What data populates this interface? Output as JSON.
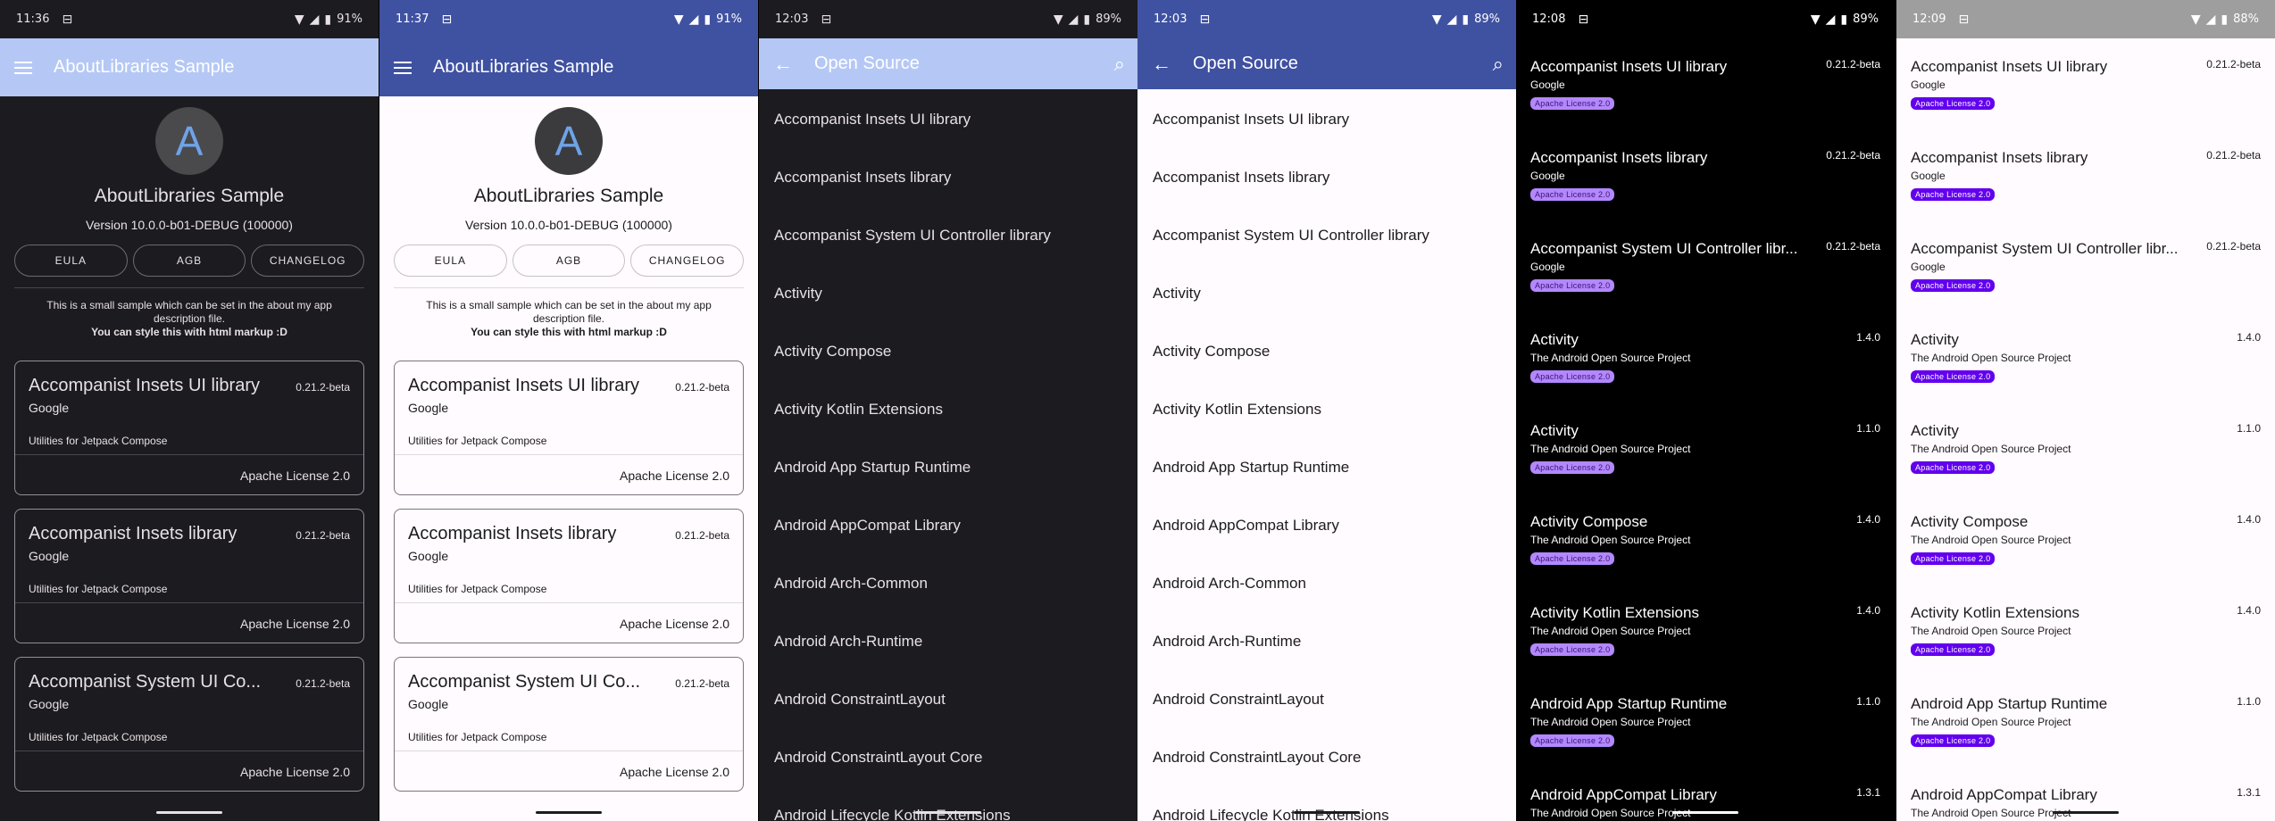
{
  "screens": [
    {
      "status": {
        "time": "11:36",
        "battery": "91%"
      },
      "appbar": {
        "title": "AboutLibraries Sample"
      },
      "header": {
        "logo_letter": "A",
        "app_name": "AboutLibraries Sample",
        "version": "Version 10.0.0-b01-DEBUG (100000)",
        "buttons": [
          "EULA",
          "AGB",
          "CHANGELOG"
        ],
        "desc_line1": "This is a small sample which can be set in the about my app description file.",
        "desc_line2": "You can style this with html markup :D"
      },
      "cards": [
        {
          "name": "Accompanist Insets UI library",
          "version": "0.21.2-beta",
          "author": "Google",
          "desc": "Utilities for Jetpack Compose",
          "license": "Apache License 2.0"
        },
        {
          "name": "Accompanist Insets library",
          "version": "0.21.2-beta",
          "author": "Google",
          "desc": "Utilities for Jetpack Compose",
          "license": "Apache License 2.0"
        },
        {
          "name": "Accompanist System UI Co...",
          "version": "0.21.2-beta",
          "author": "Google",
          "desc": "Utilities for Jetpack Compose",
          "license": "Apache License 2.0"
        }
      ]
    },
    {
      "status": {
        "time": "11:37",
        "battery": "91%"
      },
      "appbar": {
        "title": "AboutLibraries Sample"
      },
      "header": {
        "logo_letter": "A",
        "app_name": "AboutLibraries Sample",
        "version": "Version 10.0.0-b01-DEBUG (100000)",
        "buttons": [
          "EULA",
          "AGB",
          "CHANGELOG"
        ],
        "desc_line1": "This is a small sample which can be set in the about my app description file.",
        "desc_line2": "You can style this with html markup :D"
      },
      "cards": [
        {
          "name": "Accompanist Insets UI library",
          "version": "0.21.2-beta",
          "author": "Google",
          "desc": "Utilities for Jetpack Compose",
          "license": "Apache License 2.0"
        },
        {
          "name": "Accompanist Insets library",
          "version": "0.21.2-beta",
          "author": "Google",
          "desc": "Utilities for Jetpack Compose",
          "license": "Apache License 2.0"
        },
        {
          "name": "Accompanist System UI Co...",
          "version": "0.21.2-beta",
          "author": "Google",
          "desc": "Utilities for Jetpack Compose",
          "license": "Apache License 2.0"
        }
      ]
    },
    {
      "status": {
        "time": "12:03",
        "battery": "89%"
      },
      "appbar": {
        "title": "Open Source"
      },
      "items": [
        "Accompanist Insets UI library",
        "Accompanist Insets library",
        "Accompanist System UI Controller library",
        "Activity",
        "Activity Compose",
        "Activity Kotlin Extensions",
        "Android App Startup Runtime",
        "Android AppCompat Library",
        "Android Arch-Common",
        "Android Arch-Runtime",
        "Android ConstraintLayout",
        "Android ConstraintLayout Core",
        "Android Lifecycle Kotlin Extensions"
      ]
    },
    {
      "status": {
        "time": "12:03",
        "battery": "89%"
      },
      "appbar": {
        "title": "Open Source"
      },
      "items": [
        "Accompanist Insets UI library",
        "Accompanist Insets library",
        "Accompanist System UI Controller library",
        "Activity",
        "Activity Compose",
        "Activity Kotlin Extensions",
        "Android App Startup Runtime",
        "Android AppCompat Library",
        "Android Arch-Common",
        "Android Arch-Runtime",
        "Android ConstraintLayout",
        "Android ConstraintLayout Core",
        "Android Lifecycle Kotlin Extensions"
      ]
    },
    {
      "status": {
        "time": "12:08",
        "battery": "89%"
      },
      "items": [
        {
          "name": "Accompanist Insets UI library",
          "version": "0.21.2-beta",
          "author": "Google",
          "license": "Apache License 2.0"
        },
        {
          "name": "Accompanist Insets library",
          "version": "0.21.2-beta",
          "author": "Google",
          "license": "Apache License 2.0"
        },
        {
          "name": "Accompanist System UI Controller libr...",
          "version": "0.21.2-beta",
          "author": "Google",
          "license": "Apache License 2.0"
        },
        {
          "name": "Activity",
          "version": "1.4.0",
          "author": "The Android Open Source Project",
          "license": "Apache License 2.0"
        },
        {
          "name": "Activity",
          "version": "1.1.0",
          "author": "The Android Open Source Project",
          "license": "Apache License 2.0"
        },
        {
          "name": "Activity Compose",
          "version": "1.4.0",
          "author": "The Android Open Source Project",
          "license": "Apache License 2.0"
        },
        {
          "name": "Activity Kotlin Extensions",
          "version": "1.4.0",
          "author": "The Android Open Source Project",
          "license": "Apache License 2.0"
        },
        {
          "name": "Android App Startup Runtime",
          "version": "1.1.0",
          "author": "The Android Open Source Project",
          "license": "Apache License 2.0"
        },
        {
          "name": "Android AppCompat Library",
          "version": "1.3.1",
          "author": "The Android Open Source Project",
          "license": ""
        }
      ]
    },
    {
      "status": {
        "time": "12:09",
        "battery": "88%"
      },
      "items": [
        {
          "name": "Accompanist Insets UI library",
          "version": "0.21.2-beta",
          "author": "Google",
          "license": "Apache License 2.0"
        },
        {
          "name": "Accompanist Insets library",
          "version": "0.21.2-beta",
          "author": "Google",
          "license": "Apache License 2.0"
        },
        {
          "name": "Accompanist System UI Controller libr...",
          "version": "0.21.2-beta",
          "author": "Google",
          "license": "Apache License 2.0"
        },
        {
          "name": "Activity",
          "version": "1.4.0",
          "author": "The Android Open Source Project",
          "license": "Apache License 2.0"
        },
        {
          "name": "Activity",
          "version": "1.1.0",
          "author": "The Android Open Source Project",
          "license": "Apache License 2.0"
        },
        {
          "name": "Activity Compose",
          "version": "1.4.0",
          "author": "The Android Open Source Project",
          "license": "Apache License 2.0"
        },
        {
          "name": "Activity Kotlin Extensions",
          "version": "1.4.0",
          "author": "The Android Open Source Project",
          "license": "Apache License 2.0"
        },
        {
          "name": "Android App Startup Runtime",
          "version": "1.1.0",
          "author": "The Android Open Source Project",
          "license": "Apache License 2.0"
        },
        {
          "name": "Android AppCompat Library",
          "version": "1.3.1",
          "author": "The Android Open Source Project",
          "license": ""
        }
      ]
    }
  ],
  "colors": {
    "primary": "#3f51a1",
    "primary_light": "#b5c8f5",
    "chip": "#b388ff",
    "chip_text": "#4a148c"
  },
  "icons": {
    "menu": "menu-icon",
    "back": "arrow-back-icon",
    "search": "search-icon",
    "wifi": "wifi-icon",
    "signal": "signal-icon",
    "battery": "battery-icon"
  }
}
